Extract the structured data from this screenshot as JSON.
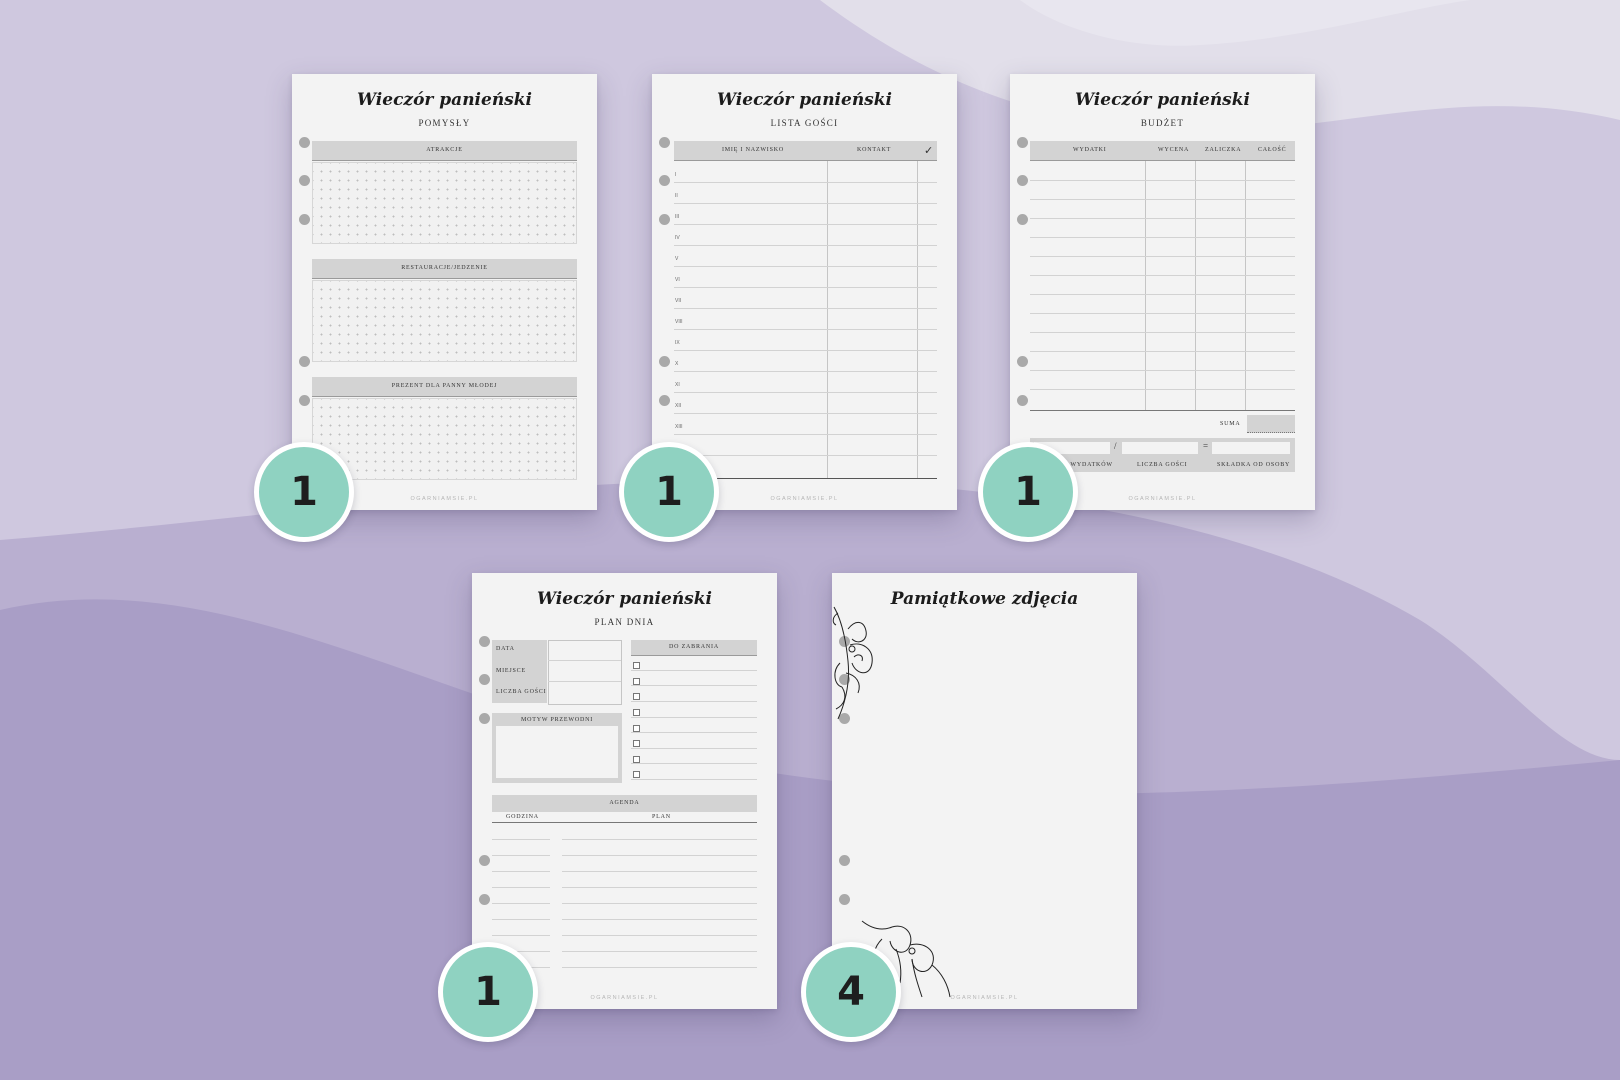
{
  "background": {
    "base": "#cfc8df",
    "light": "#e4e1ec",
    "dark": "#a89dc5"
  },
  "accent_badge": "#8fd2c1",
  "pages": {
    "pomysly": {
      "title": "Wieczór panieński",
      "subtitle": "POMYSŁY",
      "sections": [
        "ATRAKCJE",
        "RESTAURACJE/JEDZENIE",
        "PREZENT DLA PANNY MŁODEJ"
      ],
      "footer": "OGARNIAMSIE.PL"
    },
    "lista_gosci": {
      "title": "Wieczór panieński",
      "subtitle": "LISTA GOŚCI",
      "columns": [
        "IMIĘ I NAZWISKO",
        "KONTAKT",
        "✓"
      ],
      "row_numbers": [
        "I",
        "II",
        "III",
        "IV",
        "V",
        "VI",
        "VII",
        "VIII",
        "IX",
        "X",
        "XI",
        "XII",
        "XIII"
      ],
      "footer": "OGARNIAMSIE.PL"
    },
    "budzet": {
      "title": "Wieczór panieński",
      "subtitle": "BUDŻET",
      "columns": [
        "WYDATKI",
        "WYCENA",
        "ZALICZKA",
        "CAŁOŚĆ"
      ],
      "suma_label": "SUMA",
      "operators": [
        "/",
        "="
      ],
      "bottom_labels": [
        "SUMA WYDATKÓW",
        "LICZBA GOŚCI",
        "SKŁADKA OD OSOBY"
      ],
      "footer": "OGARNIAMSIE.PL"
    },
    "plan_dnia": {
      "title": "Wieczór panieński",
      "subtitle": "PLAN DNIA",
      "info_labels": [
        "DATA",
        "MIEJSCE",
        "LICZBA GOŚCI"
      ],
      "do_zabrania": "DO ZABRANIA",
      "motyw": "MOTYW PRZEWODNI",
      "agenda": "AGENDA",
      "agenda_columns": [
        "GODZINA",
        "PLAN"
      ],
      "footer": "OGARNIAMSIE.PL"
    },
    "zdjecia": {
      "title": "Pamiątkowe zdjęcia",
      "footer": "OGARNIAMSIE.PL"
    }
  },
  "badges": [
    "1",
    "1",
    "1",
    "1",
    "4"
  ]
}
